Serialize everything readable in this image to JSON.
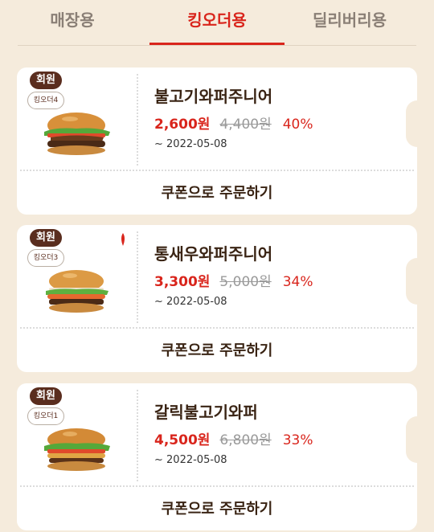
{
  "tabs": [
    {
      "label": "매장용",
      "active": false
    },
    {
      "label": "킹오더용",
      "active": true
    },
    {
      "label": "딜리버리용",
      "active": false
    }
  ],
  "coupons": [
    {
      "member_badge": "회원",
      "king_badge": "킹오더4",
      "name": "불고기와퍼주니어",
      "price": "2,600원",
      "original_price": "4,400원",
      "discount": "40%",
      "expiry": "~ 2022-05-08",
      "order_label": "쿠폰으로 주문하기"
    },
    {
      "member_badge": "회원",
      "king_badge": "킹오더3",
      "name": "통새우와퍼주니어",
      "price": "3,300원",
      "original_price": "5,000원",
      "discount": "34%",
      "expiry": "~ 2022-05-08",
      "order_label": "쿠폰으로 주문하기"
    },
    {
      "member_badge": "회원",
      "king_badge": "킹오더1",
      "name": "갈릭불고기와퍼",
      "price": "4,500원",
      "original_price": "6,800원",
      "discount": "33%",
      "expiry": "~ 2022-05-08",
      "order_label": "쿠폰으로 주문하기"
    }
  ],
  "colors": {
    "accent": "#d9251c",
    "background": "#f5ebdc",
    "brown": "#5a2d1e"
  }
}
